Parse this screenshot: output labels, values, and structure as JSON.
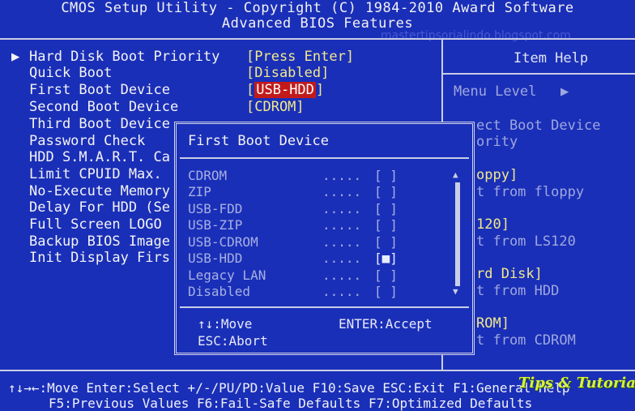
{
  "header": {
    "title": "CMOS Setup Utility - Copyright (C) 1984-2010 Award Software",
    "subtitle": "Advanced BIOS Features",
    "watermark": "mastertipsorialindo.blogspot.com"
  },
  "settings": [
    {
      "label": "Hard Disk Boot Priority",
      "value": "[Press Enter]",
      "arrow": "▶"
    },
    {
      "label": "Quick Boot",
      "value": "[Disabled]"
    },
    {
      "label": "First Boot Device",
      "value_open": "[",
      "value_sel": "USB-HDD",
      "value_close": "]"
    },
    {
      "label": "Second Boot Device",
      "value": "[CDROM]"
    },
    {
      "label": "Third Boot Device"
    },
    {
      "label": "Password Check"
    },
    {
      "label": "HDD S.M.A.R.T. Ca"
    },
    {
      "label": "Limit CPUID Max."
    },
    {
      "label": "No-Execute Memory"
    },
    {
      "label": "Delay For HDD (Se"
    },
    {
      "label": "Full Screen LOGO"
    },
    {
      "label": "Backup BIOS Image"
    },
    {
      "label": "Init Display Firs"
    }
  ],
  "help": {
    "title": "Item Help",
    "menu_level": "Menu Level",
    "menu_arrow": "▶",
    "lines": [
      {
        "text": "ect Boot Device",
        "style": "helpv"
      },
      {
        "text": "ority",
        "style": "helpv"
      },
      {
        "text": "oppy]",
        "style": "helpy"
      },
      {
        "text": "t from floppy",
        "style": "helpv"
      },
      {
        "text": "120]",
        "style": "helpy"
      },
      {
        "text": "t from LS120",
        "style": "helpv"
      },
      {
        "text": "rd Disk]",
        "style": "helpy"
      },
      {
        "text": "t from HDD",
        "style": "helpv"
      },
      {
        "text": "ROM]",
        "style": "helpy"
      },
      {
        "text": "t from CDROM",
        "style": "helpv"
      }
    ]
  },
  "popup": {
    "title": "First Boot Device",
    "options": [
      {
        "name": "CDROM",
        "dots": ".....",
        "box": "[ ]"
      },
      {
        "name": "ZIP",
        "dots": ".....",
        "box": "[ ]"
      },
      {
        "name": "USB-FDD",
        "dots": ".....",
        "box": "[ ]"
      },
      {
        "name": "USB-ZIP",
        "dots": ".....",
        "box": "[ ]"
      },
      {
        "name": "USB-CDROM",
        "dots": ".....",
        "box": "[ ]"
      },
      {
        "name": "USB-HDD",
        "dots": ".....",
        "box": "[■]"
      },
      {
        "name": "Legacy LAN",
        "dots": ".....",
        "box": "[ ]"
      },
      {
        "name": "Disabled",
        "dots": ".....",
        "box": "[ ]"
      }
    ],
    "scroll_up": "▲",
    "scroll_down": "▼",
    "hint_move": "↑↓:Move",
    "hint_enter": "ENTER:Accept",
    "hint_abort": "ESC:Abort"
  },
  "footer": {
    "line1": "↑↓→←:Move  Enter:Select  +/-/PU/PD:Value  F10:Save  ESC:Exit  F1:General Help",
    "line2": "F5:Previous Values  F6:Fail-Safe Defaults  F7:Optimized Defaults",
    "logo": "Tips & Tutorial"
  },
  "colors": {
    "background": "#1a2fb8",
    "value": "#f2e88a",
    "selected": "#c21a1a"
  }
}
